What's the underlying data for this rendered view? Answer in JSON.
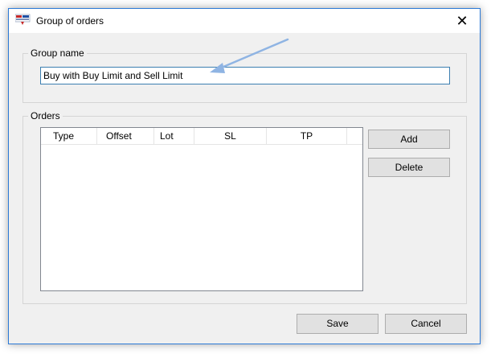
{
  "window": {
    "title": "Group of orders",
    "close_label": "✕"
  },
  "group_name": {
    "legend": "Group name",
    "input_value": "Buy with Buy Limit and Sell Limit"
  },
  "orders": {
    "legend": "Orders",
    "columns": [
      "Type",
      "Offset",
      "Lot",
      "SL",
      "TP"
    ],
    "rows": [],
    "add_label": "Add",
    "delete_label": "Delete"
  },
  "footer": {
    "save_label": "Save",
    "cancel_label": "Cancel"
  },
  "colors": {
    "accent": "#2b79d6",
    "arrow": "#8fb4e3"
  },
  "icons": {
    "app": "app-logo-icon",
    "close": "close-icon",
    "annotation": "pointer-arrow-icon"
  }
}
